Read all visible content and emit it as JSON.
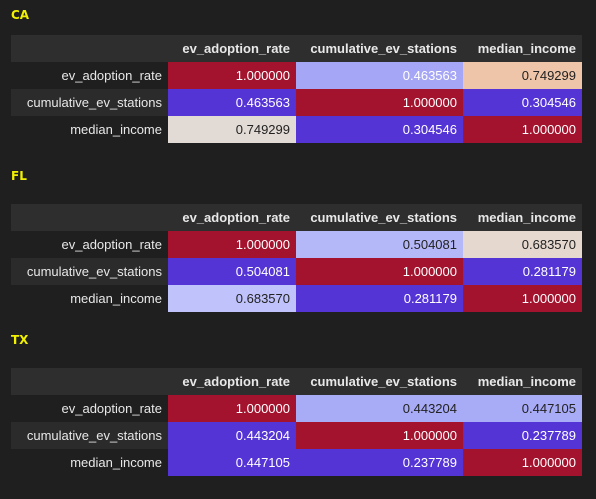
{
  "columns": [
    "ev_adoption_rate",
    "cumulative_ev_stations",
    "median_income"
  ],
  "rows": [
    "ev_adoption_rate",
    "cumulative_ev_stations",
    "median_income"
  ],
  "sections": [
    {
      "title": "CA",
      "cells": [
        [
          {
            "v": "1.000000",
            "bg": "#a3132e",
            "fg": "#ffffff"
          },
          {
            "v": "0.463563",
            "bg": "#a6a6f6",
            "fg": "#ffffff"
          },
          {
            "v": "0.749299",
            "bg": "#eec5a8",
            "fg": "#222222"
          }
        ],
        [
          {
            "v": "0.463563",
            "bg": "#5534d6",
            "fg": "#ffffff"
          },
          {
            "v": "1.000000",
            "bg": "#a3132e",
            "fg": "#ffffff"
          },
          {
            "v": "0.304546",
            "bg": "#5534d6",
            "fg": "#ffffff"
          }
        ],
        [
          {
            "v": "0.749299",
            "bg": "#e2dad4",
            "fg": "#222222"
          },
          {
            "v": "0.304546",
            "bg": "#5534d6",
            "fg": "#ffffff"
          },
          {
            "v": "1.000000",
            "bg": "#a3132e",
            "fg": "#ffffff"
          }
        ]
      ]
    },
    {
      "title": "FL",
      "cells": [
        [
          {
            "v": "1.000000",
            "bg": "#a3132e",
            "fg": "#ffffff"
          },
          {
            "v": "0.504081",
            "bg": "#b5b8f8",
            "fg": "#222222"
          },
          {
            "v": "0.683570",
            "bg": "#e5d8cf",
            "fg": "#222222"
          }
        ],
        [
          {
            "v": "0.504081",
            "bg": "#5534d6",
            "fg": "#ffffff"
          },
          {
            "v": "1.000000",
            "bg": "#a3132e",
            "fg": "#ffffff"
          },
          {
            "v": "0.281179",
            "bg": "#5534d6",
            "fg": "#ffffff"
          }
        ],
        [
          {
            "v": "0.683570",
            "bg": "#c0c3fb",
            "fg": "#222222"
          },
          {
            "v": "0.281179",
            "bg": "#5534d6",
            "fg": "#ffffff"
          },
          {
            "v": "1.000000",
            "bg": "#a3132e",
            "fg": "#ffffff"
          }
        ]
      ]
    },
    {
      "title": "TX",
      "cells": [
        [
          {
            "v": "1.000000",
            "bg": "#a3132e",
            "fg": "#ffffff"
          },
          {
            "v": "0.443204",
            "bg": "#a8abf6",
            "fg": "#222222"
          },
          {
            "v": "0.447105",
            "bg": "#a8abf6",
            "fg": "#222222"
          }
        ],
        [
          {
            "v": "0.443204",
            "bg": "#5534d6",
            "fg": "#ffffff"
          },
          {
            "v": "1.000000",
            "bg": "#a3132e",
            "fg": "#ffffff"
          },
          {
            "v": "0.237789",
            "bg": "#5534d6",
            "fg": "#ffffff"
          }
        ],
        [
          {
            "v": "0.447105",
            "bg": "#5534d6",
            "fg": "#ffffff"
          },
          {
            "v": "0.237789",
            "bg": "#5534d6",
            "fg": "#ffffff"
          },
          {
            "v": "1.000000",
            "bg": "#a3132e",
            "fg": "#ffffff"
          }
        ]
      ]
    }
  ]
}
